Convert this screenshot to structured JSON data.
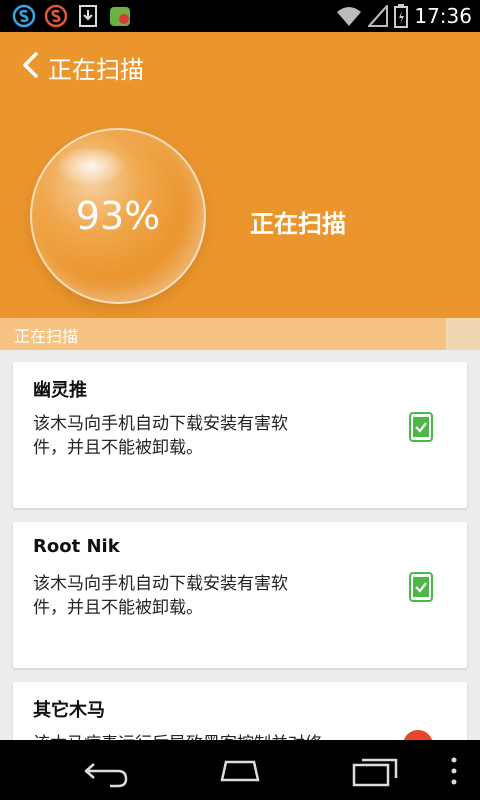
{
  "status_bar": {
    "time": "17:36",
    "icons": [
      "s-app-icon",
      "s-app-icon-red",
      "download-icon",
      "shield-app-icon",
      "wifi-icon",
      "signal-icon",
      "battery-icon"
    ]
  },
  "header": {
    "title": "正在扫描",
    "progress_percent_text": "93%",
    "status_text": "正在扫描",
    "progress_fraction": 0.93
  },
  "progress_strip": {
    "label": "正在扫描"
  },
  "cards": [
    {
      "title": "幽灵推",
      "desc_line1": "该木马向手机自动下载安装有害软",
      "desc_line2": "件，并且不能被卸载。",
      "status": "check"
    },
    {
      "title": "Root Nik",
      "desc_line1": "该木马向手机自动下载安装有害软",
      "desc_line2": "件，并且不能被卸载。",
      "status": "check"
    },
    {
      "title": "其它木马",
      "desc_line1": "该木马病毒运行后导致黑客控制并对修",
      "desc_line2": "",
      "status": "alert"
    }
  ],
  "colors": {
    "header_bg": "#EB962D",
    "check_green": "#4CB848",
    "alert_red": "#E8462A"
  }
}
